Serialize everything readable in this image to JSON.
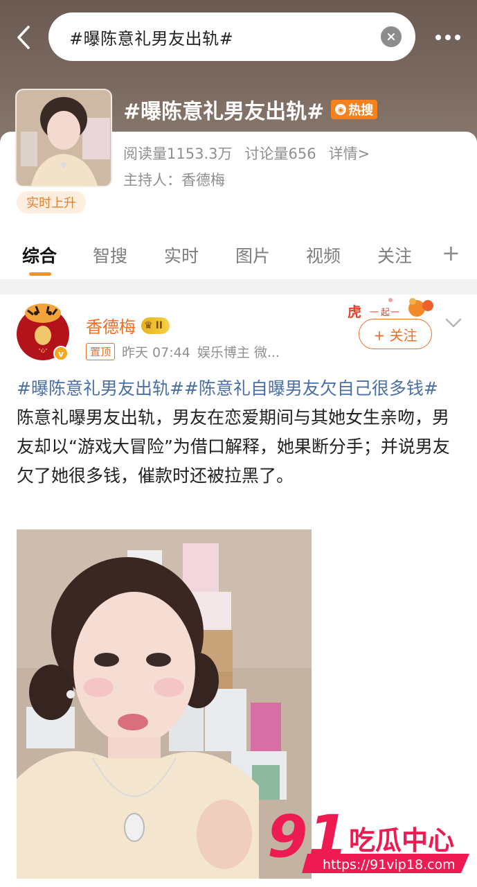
{
  "header": {
    "search_text": "#曝陈意礼男友出轨#"
  },
  "topic": {
    "title": "#曝陈意礼男友出轨#",
    "hot_badge": "热搜",
    "reads": "阅读量1153.3万",
    "discussions": "讨论量656",
    "details": "详情>",
    "host": "主持人：香德梅",
    "rising": "实时上升"
  },
  "tabs": {
    "items": [
      "综合",
      "智搜",
      "实时",
      "图片",
      "视频",
      "关注"
    ],
    "active": "综合",
    "plus": "+"
  },
  "post": {
    "author": "香德梅",
    "vip_level": "II",
    "pinned": "置顶",
    "time": "昨天 07:44",
    "source": "娱乐博主 微...",
    "follow_label": "+ 关注",
    "tag1": "#曝陈意礼男友出轨#",
    "tag2": "#陈意礼自曝男友欠自己很多钱#",
    "body": "陈意礼曝男友出轨，男友在恋爱期间与其她女生亲吻，男友却以“游戏大冒险”为借口解释，她果断分手；并说男友欠了她很多钱，催款时还被拉黑了。"
  },
  "watermark": {
    "brand_num": "91",
    "brand_text": "吃瓜中心",
    "url": "https://91vip18.com"
  },
  "colors": {
    "accent": "#f36c21",
    "tag": "#4a6fa5",
    "tab_indicator": "#f7931e",
    "hot": "#f6821f"
  }
}
